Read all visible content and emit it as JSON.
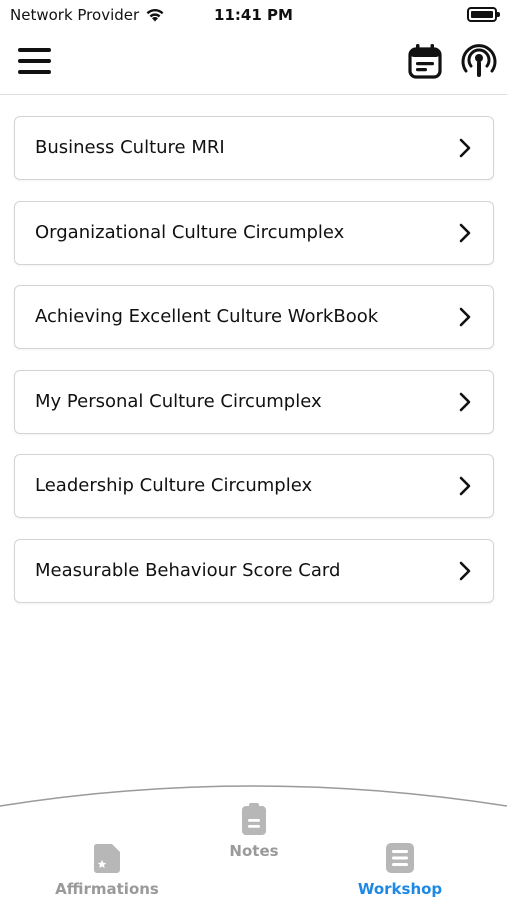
{
  "status_bar": {
    "carrier": "Network Provider",
    "time": "11:41 PM"
  },
  "header": {
    "menu_icon": "hamburger-menu-icon",
    "calendar_icon": "calendar-icon",
    "podcast_icon": "podcast-icon"
  },
  "list": {
    "items": [
      {
        "label": "Business Culture MRI"
      },
      {
        "label": "Organizational Culture Circumplex"
      },
      {
        "label": "Achieving Excellent Culture WorkBook"
      },
      {
        "label": "My Personal Culture Circumplex"
      },
      {
        "label": "Leadership Culture Circumplex"
      },
      {
        "label": "Measurable Behaviour Score Card"
      }
    ]
  },
  "tab_bar": {
    "tabs": [
      {
        "label": "Affirmations",
        "icon": "affirmations-icon",
        "active": false
      },
      {
        "label": "Notes",
        "icon": "notes-icon",
        "active": false
      },
      {
        "label": "Workshop",
        "icon": "workshop-icon",
        "active": true
      }
    ],
    "active_color": "#1e88e5",
    "inactive_color": "#9a9a9a"
  }
}
